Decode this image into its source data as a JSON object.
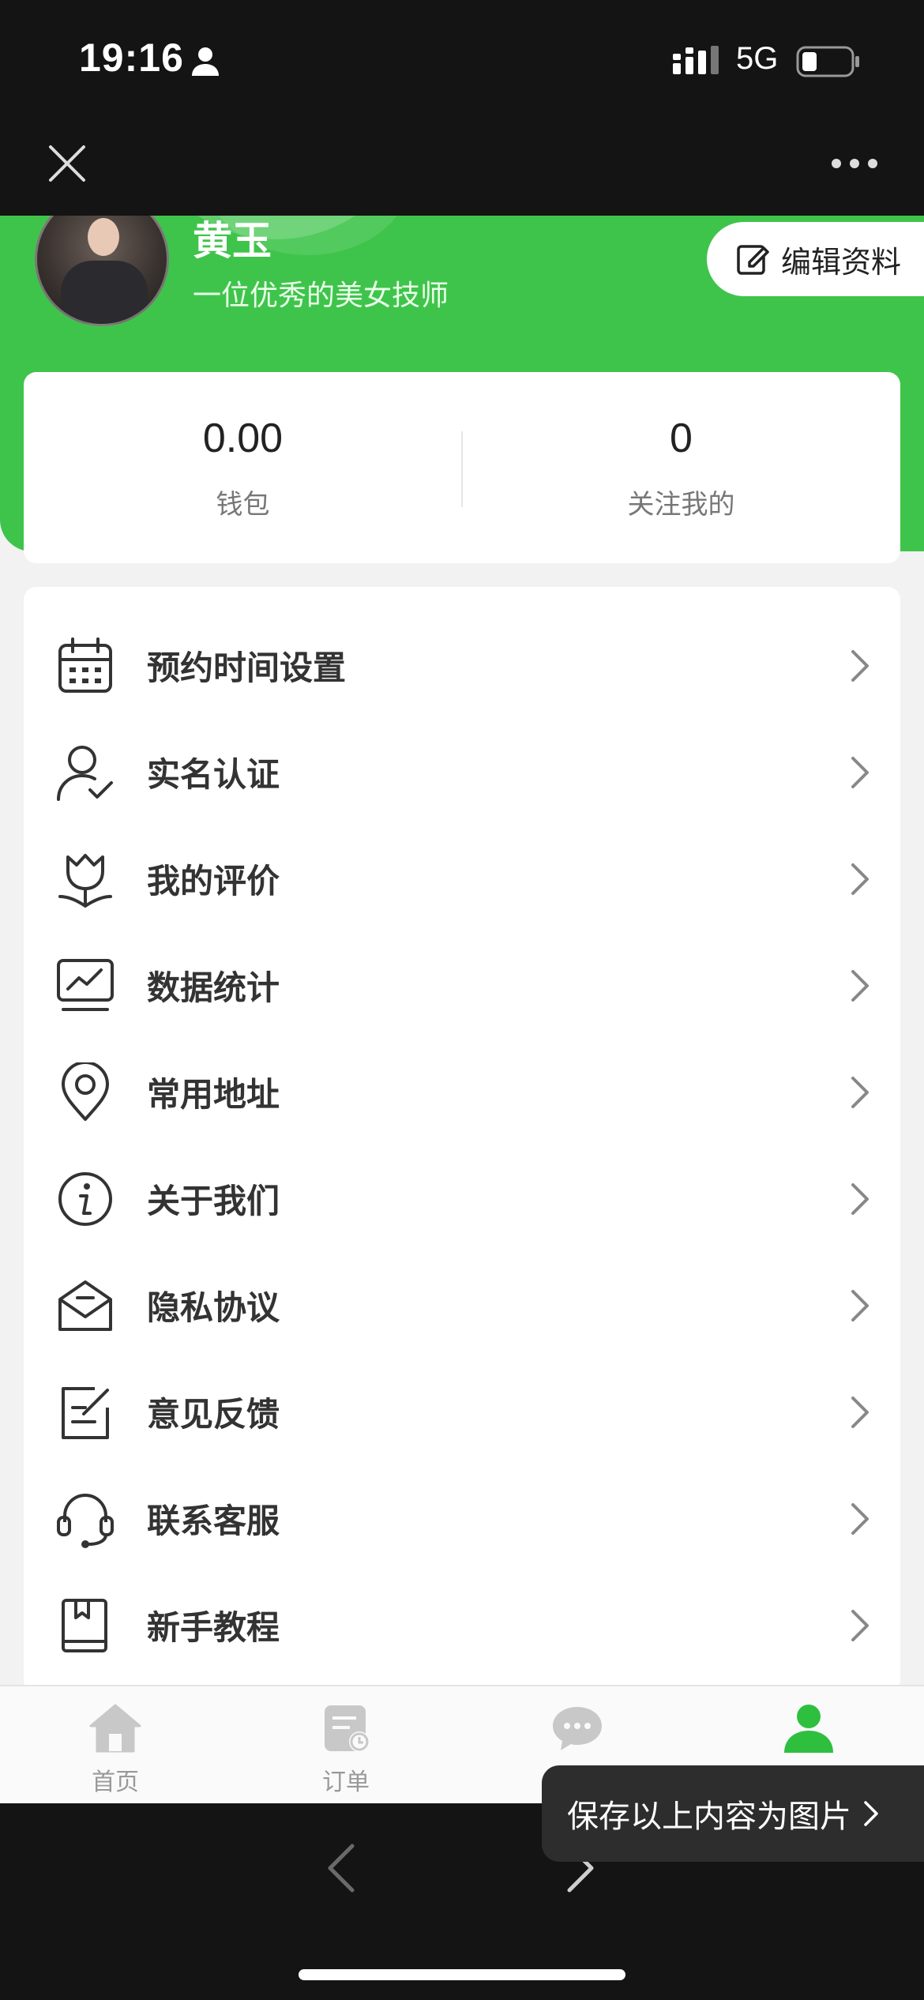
{
  "status_bar": {
    "time": "19:16",
    "network": "5G"
  },
  "profile": {
    "name": "黄玉",
    "intro": "一位优秀的美女技师",
    "edit_label": "编辑资料"
  },
  "stats": [
    {
      "value": "0.00",
      "label": "钱包"
    },
    {
      "value": "0",
      "label": "关注我的"
    }
  ],
  "menu": [
    {
      "label": "预约时间设置",
      "icon": "calendar-icon"
    },
    {
      "label": "实名认证",
      "icon": "user-check-icon"
    },
    {
      "label": "我的评价",
      "icon": "tulip-icon"
    },
    {
      "label": "数据统计",
      "icon": "chart-monitor-icon"
    },
    {
      "label": "常用地址",
      "icon": "location-pin-icon"
    },
    {
      "label": "关于我们",
      "icon": "info-icon"
    },
    {
      "label": "隐私协议",
      "icon": "envelope-icon"
    },
    {
      "label": "意见反馈",
      "icon": "feedback-edit-icon"
    },
    {
      "label": "联系客服",
      "icon": "headset-icon"
    },
    {
      "label": "新手教程",
      "icon": "book-icon"
    }
  ],
  "tabs": [
    {
      "label": "首页",
      "icon": "home-icon"
    },
    {
      "label": "订单",
      "icon": "order-icon"
    },
    {
      "label": "",
      "icon": "message-icon"
    },
    {
      "label": "",
      "icon": "profile-icon",
      "active": true
    }
  ],
  "save_toast": {
    "label": "保存以上内容为图片"
  },
  "colors": {
    "brand_green": "#3fc44b",
    "active_tab": "#2fbf3f",
    "inactive_tab": "#c8c8c8"
  }
}
